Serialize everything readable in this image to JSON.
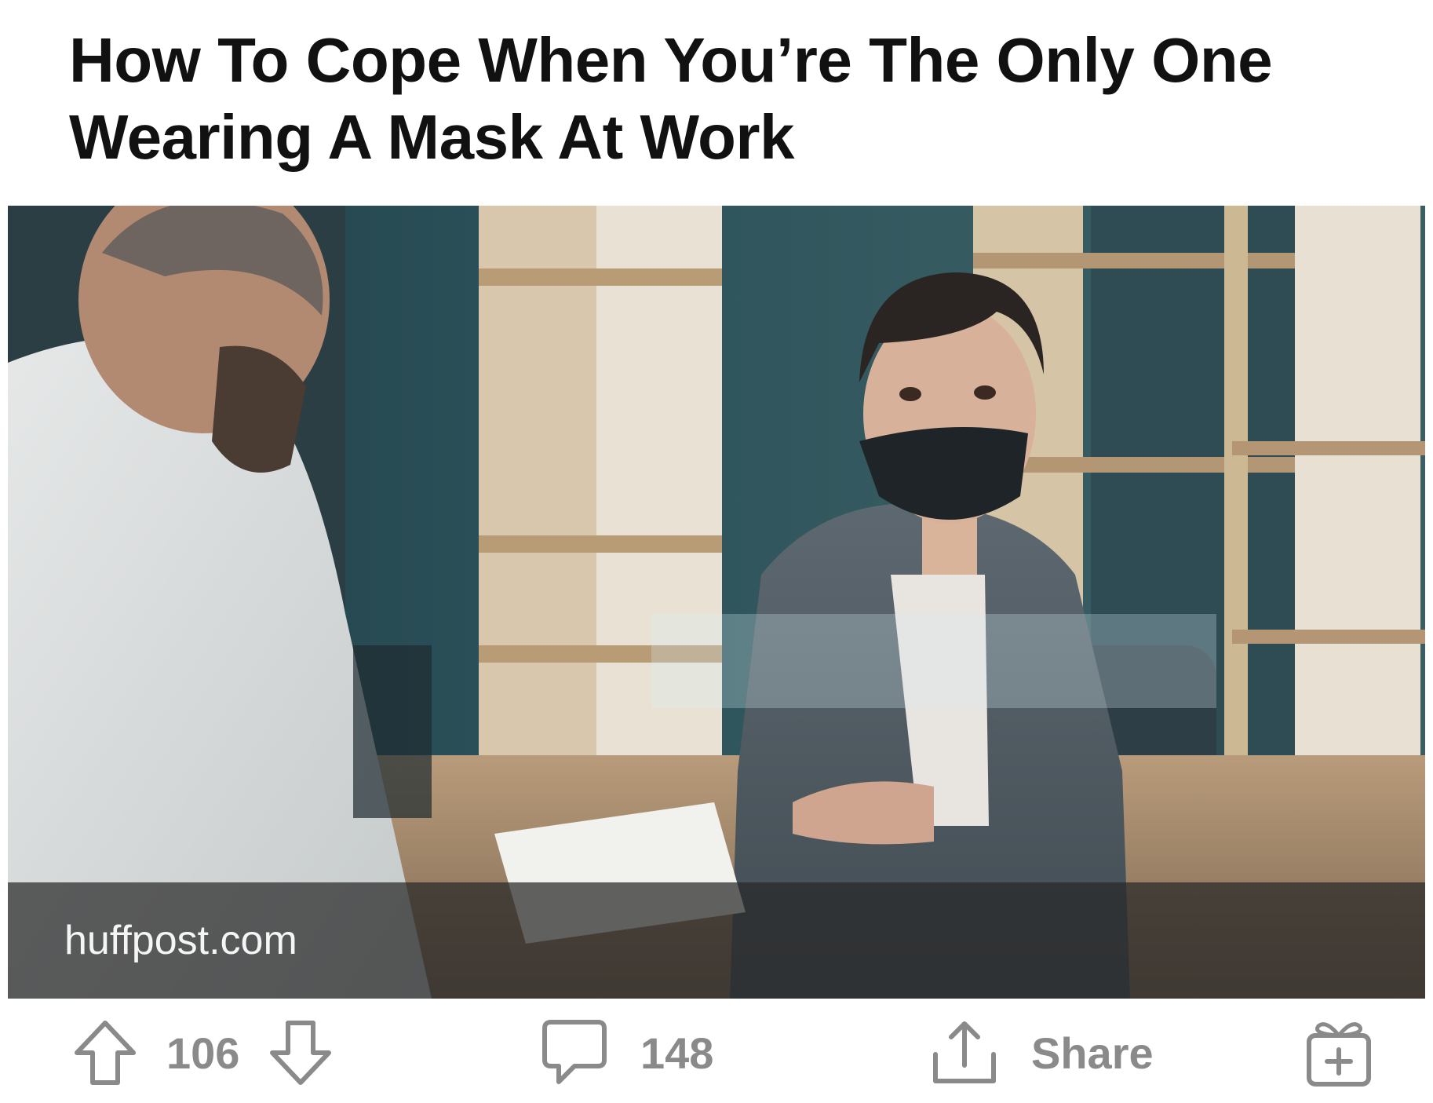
{
  "post": {
    "title": "How To Cope When You’re The Only One Wearing A Mask At Work",
    "link": {
      "domain": "huffpost.com",
      "thumbnail_alt": "Woman wearing a black face mask at a desk across from a man, with a clear partition between them"
    }
  },
  "actions": {
    "upvote_icon": "arrow-up-outline-icon",
    "vote_count": "106",
    "downvote_icon": "arrow-down-outline-icon",
    "comment_icon": "speech-bubble-icon",
    "comment_count": "148",
    "share_icon": "share-upload-icon",
    "share_label": "Share",
    "award_icon": "gift-box-plus-icon"
  },
  "colors": {
    "action_gray": "#8a8a8a",
    "title_text": "#111111",
    "source_bar_overlay": "rgba(40,40,40,0.72)"
  }
}
